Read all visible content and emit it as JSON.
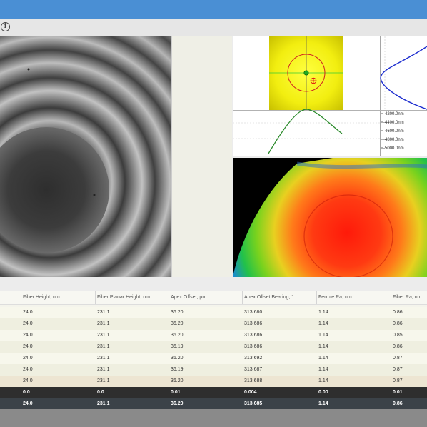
{
  "columns": [
    "Fiber Height, nm",
    "Fiber Planar Height, nm",
    "Apex Offset, μm",
    "Apex Offset Bearing, °",
    "Ferrule Ra, nm",
    "Fiber Ra, nm"
  ],
  "rows": [
    [
      "24.0",
      "231.1",
      "36.20",
      "313.680",
      "1.14",
      "0.86"
    ],
    [
      "24.0",
      "231.1",
      "36.20",
      "313.686",
      "1.14",
      "0.86"
    ],
    [
      "24.0",
      "231.1",
      "36.20",
      "313.686",
      "1.14",
      "0.85"
    ],
    [
      "24.0",
      "231.1",
      "36.19",
      "313.686",
      "1.14",
      "0.86"
    ],
    [
      "24.0",
      "231.1",
      "36.20",
      "313.692",
      "1.14",
      "0.87"
    ],
    [
      "24.0",
      "231.1",
      "36.19",
      "313.687",
      "1.14",
      "0.87"
    ],
    [
      "24.0",
      "231.1",
      "36.20",
      "313.688",
      "1.14",
      "0.87"
    ]
  ],
  "summary_rows": [
    [
      "0.0",
      "0.0",
      "0.01",
      "0.004",
      "0.00",
      "0.01"
    ],
    [
      "24.0",
      "231.1",
      "36.20",
      "313.685",
      "1.14",
      "0.86"
    ]
  ],
  "profile_ticks": [
    "-4200.0nm",
    "-4400.0nm",
    "-4600.0nm",
    "-4800.0nm",
    "-5000.0nm"
  ],
  "colors": {
    "titlebar": "#4a8fd4",
    "summary_dark": "#2e2e2e",
    "summary_slate": "#3b4248",
    "profile_vertical": "#1f2fd0",
    "profile_horizontal": "#2a8a2a"
  },
  "icons": {
    "info": "i"
  }
}
